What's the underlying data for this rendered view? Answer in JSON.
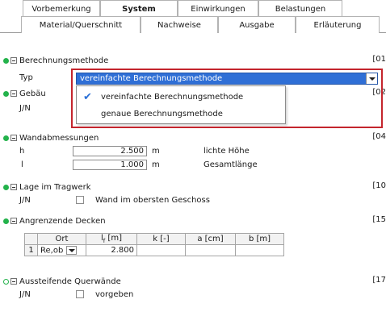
{
  "tabs_row1": [
    {
      "label": "Vorbemerkung",
      "active": false
    },
    {
      "label": "System",
      "active": true
    },
    {
      "label": "Einwirkungen",
      "active": false
    },
    {
      "label": "Belastungen",
      "active": false
    }
  ],
  "tabs_row2": [
    {
      "label": "Material/Querschnitt"
    },
    {
      "label": "Nachweise"
    },
    {
      "label": "Ausgabe"
    },
    {
      "label": "Erläuterung"
    }
  ],
  "sections": {
    "berechnung": {
      "title": "Berechnungsmethode",
      "ref": "[01",
      "typ_label": "Typ",
      "typ_value": "vereinfachte Berechnungsmethode"
    },
    "gebaeude": {
      "title": "Gebäu",
      "ref": "[02",
      "jn_label": "J/N"
    },
    "wandabmessungen": {
      "title": "Wandabmessungen",
      "ref": "[04",
      "rows": [
        {
          "sym": "h",
          "value": "2.500",
          "unit": "m",
          "desc": "lichte Höhe"
        },
        {
          "sym": "l",
          "value": "1.000",
          "unit": "m",
          "desc": "Gesamtlänge"
        }
      ]
    },
    "lage": {
      "title": "Lage im Tragwerk",
      "ref": "[10",
      "jn_label": "J/N",
      "check_label": "Wand im obersten Geschoss"
    },
    "decken": {
      "title": "Angrenzende Decken",
      "ref": "[15",
      "columns": [
        "Ort",
        "l",
        "k [-]",
        "a [cm]",
        "b [m]"
      ],
      "col_l_sub": "f",
      "col_l_unit": " [m]",
      "rows": [
        {
          "num": "1",
          "ort": "Re,ob",
          "lf": "2.800",
          "k": "",
          "a": "",
          "b": ""
        }
      ]
    },
    "quer": {
      "title": "Aussteifende Querwände",
      "ref": "[17",
      "jn_label": "J/N",
      "check_label": "vorgeben"
    }
  },
  "dropdown_options": [
    {
      "label": "vereinfachte Berechnungsmethode",
      "selected": true
    },
    {
      "label": "genaue Berechnungsmethode",
      "selected": false
    }
  ],
  "colors": {
    "status_green": "#23b24b",
    "selection_blue": "#2f6fd6",
    "highlight_red": "#c4252d"
  }
}
